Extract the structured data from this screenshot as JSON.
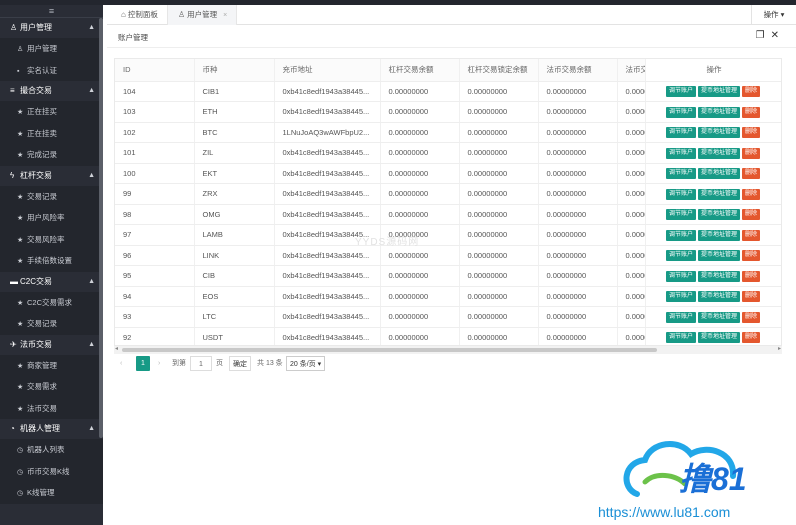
{
  "sidebar": {
    "toggle_icon": "hamburger-icon",
    "groups": [
      {
        "label": "用户管理",
        "icon": "user-icon",
        "items": [
          {
            "label": "用户管理",
            "icon": "user-icon"
          },
          {
            "label": "实名认证",
            "icon": "id-card-icon"
          }
        ]
      },
      {
        "label": "撮合交易",
        "icon": "list-icon",
        "items": [
          {
            "label": "正在挂买",
            "icon": "star-icon"
          },
          {
            "label": "正在挂卖",
            "icon": "star-icon"
          },
          {
            "label": "完成记录",
            "icon": "star-icon"
          }
        ]
      },
      {
        "label": "杠杆交易",
        "icon": "chart-icon",
        "items": [
          {
            "label": "交易记录",
            "icon": "star-icon"
          },
          {
            "label": "用户风险率",
            "icon": "star-icon"
          },
          {
            "label": "交易风险率",
            "icon": "star-icon"
          },
          {
            "label": "手续倍数设置",
            "icon": "star-icon"
          }
        ]
      },
      {
        "label": "C2C交易",
        "icon": "chat-icon",
        "items": [
          {
            "label": "C2C交易需求",
            "icon": "star-icon"
          },
          {
            "label": "交易记录",
            "icon": "star-icon"
          }
        ]
      },
      {
        "label": "法币交易",
        "icon": "rocket-icon",
        "items": [
          {
            "label": "商家管理",
            "icon": "star-icon"
          },
          {
            "label": "交易需求",
            "icon": "star-icon"
          },
          {
            "label": "法币交易",
            "icon": "star-icon"
          }
        ]
      },
      {
        "label": "机器人管理",
        "icon": "robot-icon",
        "items": [
          {
            "label": "机器人列表",
            "icon": "clock-icon"
          },
          {
            "label": "币币交易K线",
            "icon": "clock-icon"
          },
          {
            "label": "K线管理",
            "icon": "clock-icon"
          }
        ]
      }
    ]
  },
  "tabs": [
    {
      "label": "控制面板",
      "icon": "home-icon"
    },
    {
      "label": "用户管理",
      "icon": "user-icon",
      "close": "×"
    }
  ],
  "ops_label": "操作 ▾",
  "panel": {
    "title": "账户管理"
  },
  "table": {
    "headers": [
      "ID",
      "币种",
      "充币地址",
      "杠杆交易余额",
      "杠杆交易锁定余额",
      "法币交易余额",
      "法币交",
      "操作"
    ],
    "action_labels": [
      "调节账户",
      "提币地址管理",
      "删除"
    ],
    "rows": [
      [
        "104",
        "CIB1",
        "0xb41c8edf1943a38445...",
        "0.00000000",
        "0.00000000",
        "0.00000000",
        "0.0000"
      ],
      [
        "103",
        "ETH",
        "0xb41c8edf1943a38445...",
        "0.00000000",
        "0.00000000",
        "0.00000000",
        "0.0000"
      ],
      [
        "102",
        "BTC",
        "1LNuJoAQ3wAWFbpU2...",
        "0.00000000",
        "0.00000000",
        "0.00000000",
        "0.0000"
      ],
      [
        "101",
        "ZIL",
        "0xb41c8edf1943a38445...",
        "0.00000000",
        "0.00000000",
        "0.00000000",
        "0.0000"
      ],
      [
        "100",
        "EKT",
        "0xb41c8edf1943a38445...",
        "0.00000000",
        "0.00000000",
        "0.00000000",
        "0.0000"
      ],
      [
        "99",
        "ZRX",
        "0xb41c8edf1943a38445...",
        "0.00000000",
        "0.00000000",
        "0.00000000",
        "0.0000"
      ],
      [
        "98",
        "OMG",
        "0xb41c8edf1943a38445...",
        "0.00000000",
        "0.00000000",
        "0.00000000",
        "0.0000"
      ],
      [
        "97",
        "LAMB",
        "0xb41c8edf1943a38445...",
        "0.00000000",
        "0.00000000",
        "0.00000000",
        "0.0000"
      ],
      [
        "96",
        "LINK",
        "0xb41c8edf1943a38445...",
        "0.00000000",
        "0.00000000",
        "0.00000000",
        "0.0000"
      ],
      [
        "95",
        "CIB",
        "0xb41c8edf1943a38445...",
        "0.00000000",
        "0.00000000",
        "0.00000000",
        "0.0000"
      ],
      [
        "94",
        "EOS",
        "0xb41c8edf1943a38445...",
        "0.00000000",
        "0.00000000",
        "0.00000000",
        "0.0000"
      ],
      [
        "93",
        "LTC",
        "0xb41c8edf1943a38445...",
        "0.00000000",
        "0.00000000",
        "0.00000000",
        "0.0000"
      ],
      [
        "92",
        "USDT",
        "0xb41c8edf1943a38445...",
        "0.00000000",
        "0.00000000",
        "0.00000000",
        "0.0000"
      ]
    ]
  },
  "pagination": {
    "prev": "‹",
    "current": "1",
    "next": "›",
    "goto_label": "到第",
    "goto_value": "1",
    "page_unit": "页",
    "confirm": "确定",
    "total": "共 13 条",
    "page_size": "20 条/页 ▾"
  },
  "watermark": {
    "center": "YYDS源码网",
    "logo_text": "撸81",
    "url": "https://www.lu81.com"
  },
  "colors": {
    "sidebar_bg": "#2a2d36",
    "accent": "#179a86",
    "danger": "#e4572e",
    "brand_blue": "#1a8fd6"
  }
}
